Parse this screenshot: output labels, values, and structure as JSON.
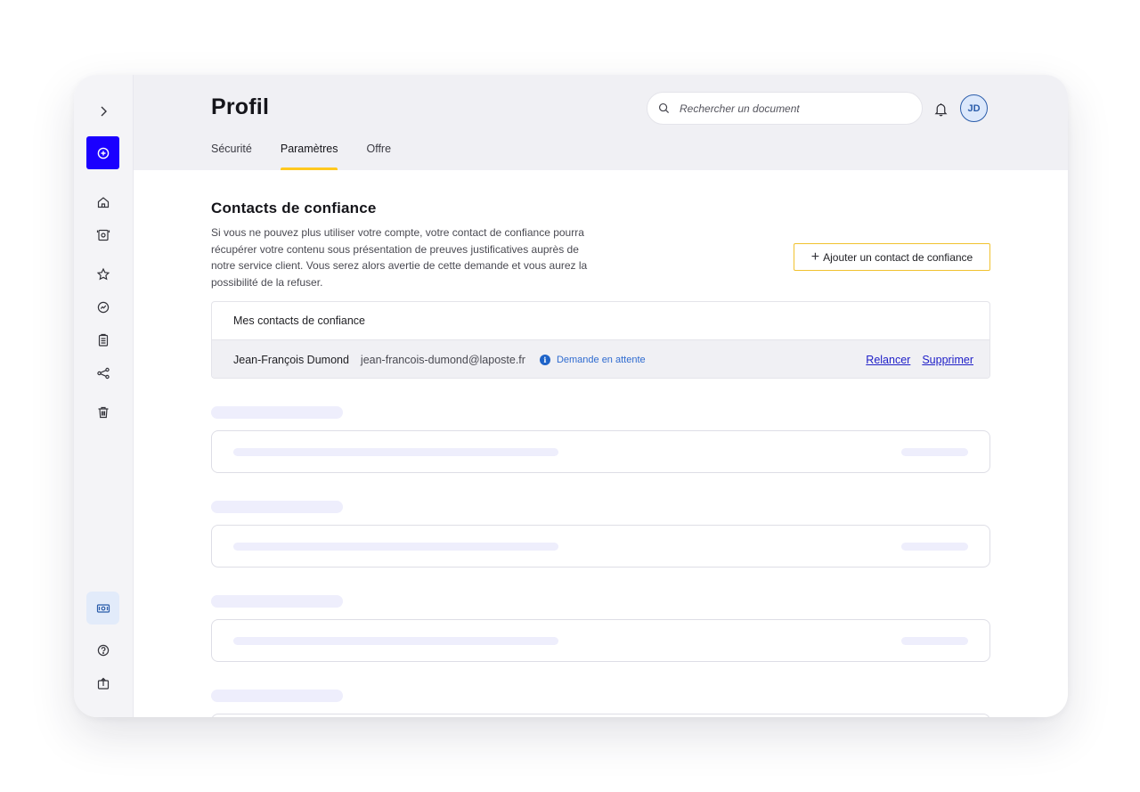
{
  "page": {
    "title": "Profil",
    "tabs": [
      {
        "label": "Sécurité",
        "active": false
      },
      {
        "label": "Paramètres",
        "active": true
      },
      {
        "label": "Offre",
        "active": false
      }
    ]
  },
  "search": {
    "placeholder": "Rechercher un document",
    "icon": "search-icon"
  },
  "user": {
    "initials": "JD"
  },
  "sidebar": {
    "items": [
      {
        "name": "expand",
        "icon": "chevron-right-icon"
      },
      {
        "name": "add",
        "icon": "plus-circle-icon"
      },
      {
        "name": "home",
        "icon": "home-icon"
      },
      {
        "name": "scanner",
        "icon": "scan-icon"
      },
      {
        "name": "favorites",
        "icon": "star-icon"
      },
      {
        "name": "activity",
        "icon": "gauge-icon"
      },
      {
        "name": "clipboard",
        "icon": "clipboard-icon"
      },
      {
        "name": "share",
        "icon": "share-icon"
      },
      {
        "name": "trash",
        "icon": "trash-icon"
      },
      {
        "name": "offer",
        "icon": "banknote-icon"
      },
      {
        "name": "help",
        "icon": "help-icon"
      },
      {
        "name": "export",
        "icon": "upload-box-icon"
      }
    ]
  },
  "trusted_contacts": {
    "title": "Contacts de confiance",
    "description": "Si vous ne pouvez plus utiliser votre compte, votre contact de confiance pourra récupérer votre contenu sous présentation de preuves justificatives auprès de notre service client. Vous serez alors avertie de cette demande et vous aurez la possibilité de la refuser.",
    "add_button_label": "Ajouter un contact de confiance",
    "list_title": "Mes contacts de confiance",
    "contacts": [
      {
        "name": "Jean-François Dumond",
        "email": "jean-francois-dumond@laposte.fr",
        "status": "Demande en attente",
        "actions": {
          "resend": "Relancer",
          "delete": "Supprimer"
        }
      }
    ]
  },
  "colors": {
    "accent_blue": "#1a00ff",
    "tab_indicator": "#ffc81e",
    "link": "#2020c8",
    "status_blue": "#2f6bd0",
    "header_bg": "#f0f0f4",
    "skeleton": "#eeeefc"
  }
}
